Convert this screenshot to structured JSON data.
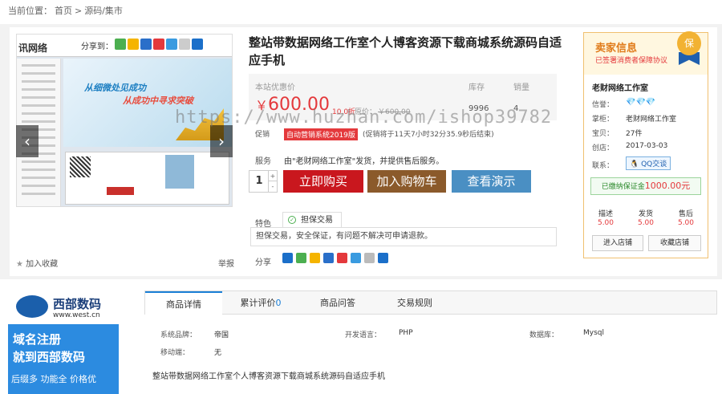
{
  "breadcrumb": {
    "prefix": "当前位置：",
    "home": "首页",
    "sep1": ">",
    "category": "源码/集市"
  },
  "gallery": {
    "logo": "讯网络",
    "share_label": "分享到：",
    "banner_line1": "从细微处见成功",
    "banner_line2": "从成功中寻求突破"
  },
  "actions": {
    "favorite": "加入收藏",
    "report": "举报"
  },
  "product": {
    "title": "整站带数据网络工作室个人博客资源下载商城系统源码自适应手机",
    "price_label": "本站优惠价",
    "currency": "￥",
    "price": "600.00",
    "discount": "10.0折",
    "orig_label": "原价：",
    "orig_price": "￥600.00",
    "stock_label": "库存",
    "stock": "9996",
    "sales_label": "销量",
    "sales": "4",
    "promo_label": "促销",
    "promo_tag": "自动营销系统2019版",
    "promo_text": "(促销将于11天7小时32分35.9秒后结束)",
    "service_label": "服务",
    "service_text": "由\"老财网络工作室\"发货，并提供售后服务。",
    "qty": "1",
    "qty_plus": "+",
    "qty_minus": "-",
    "buy_now": "立即购买",
    "add_cart": "加入购物车",
    "view_demo": "查看演示",
    "feature_label": "特色",
    "feature_tab": "担保交易",
    "feature_text": "担保交易，安全保证，有问题不解决可申请退款。",
    "share_label": "分享"
  },
  "seller": {
    "header": "卖家信息",
    "subheader": "已签署消费者保障协议",
    "medal": "保",
    "name": "老财网络工作室",
    "credit_label": "信誉：",
    "credit_value": "💎💎💎",
    "owner_label": "掌柜：",
    "owner": "老财网络工作室",
    "items_label": "宝贝：",
    "items": "27件",
    "created_label": "创店：",
    "created": "2017-03-03",
    "contact_label": "联系：",
    "contact": "QQ交谈",
    "deposit_prefix": "已缴纳保证金",
    "deposit": "1000.00元",
    "desc_label": "描述",
    "desc_score": "5.00",
    "ship_label": "发货",
    "ship_score": "5.00",
    "after_label": "售后",
    "after_score": "5.00",
    "enter_shop": "进入店铺",
    "fav_shop": "收藏店铺"
  },
  "ad": {
    "brand": "西部数码",
    "url": "www.west.cn",
    "line1": "域名注册",
    "line2": "就到西部数码",
    "line3": "后缀多 功能全 价格优"
  },
  "tabs": [
    {
      "label": "商品详情"
    },
    {
      "label": "累计评价",
      "count": "0"
    },
    {
      "label": "商品问答"
    },
    {
      "label": "交易规则"
    }
  ],
  "specs": {
    "brand_label": "系统品牌：",
    "brand": "帝国",
    "lang_label": "开发语言：",
    "lang": "PHP",
    "db_label": "数据库：",
    "db": "Mysql",
    "mobile_label": "移动端：",
    "mobile": "无"
  },
  "description": "整站带数据网络工作室个人博客资源下载商城系统源码自适应手机",
  "watermark": "https://www.huzhan.com/ishop39782"
}
